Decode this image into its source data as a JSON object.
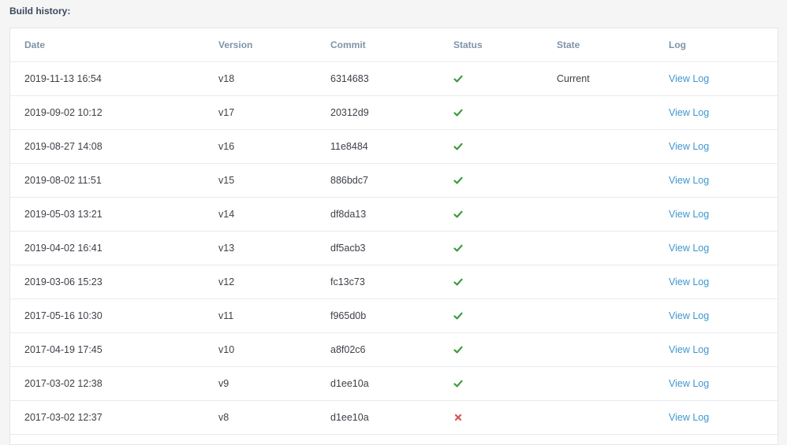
{
  "title": "Build history:",
  "columns": {
    "date": "Date",
    "version": "Version",
    "commit": "Commit",
    "status": "Status",
    "state": "State",
    "log": "Log"
  },
  "colors": {
    "success": "#3c9a3c",
    "failure": "#d9534f",
    "link": "#3f96cf"
  },
  "builds": [
    {
      "date": "2019-11-13 16:54",
      "version": "v18",
      "commit": "6314683",
      "status": "success",
      "state": "Current",
      "log": "View Log"
    },
    {
      "date": "2019-09-02 10:12",
      "version": "v17",
      "commit": "20312d9",
      "status": "success",
      "state": "",
      "log": "View Log"
    },
    {
      "date": "2019-08-27 14:08",
      "version": "v16",
      "commit": "11e8484",
      "status": "success",
      "state": "",
      "log": "View Log"
    },
    {
      "date": "2019-08-02 11:51",
      "version": "v15",
      "commit": "886bdc7",
      "status": "success",
      "state": "",
      "log": "View Log"
    },
    {
      "date": "2019-05-03 13:21",
      "version": "v14",
      "commit": "df8da13",
      "status": "success",
      "state": "",
      "log": "View Log"
    },
    {
      "date": "2019-04-02 16:41",
      "version": "v13",
      "commit": "df5acb3",
      "status": "success",
      "state": "",
      "log": "View Log"
    },
    {
      "date": "2019-03-06 15:23",
      "version": "v12",
      "commit": "fc13c73",
      "status": "success",
      "state": "",
      "log": "View Log"
    },
    {
      "date": "2017-05-16 10:30",
      "version": "v11",
      "commit": "f965d0b",
      "status": "success",
      "state": "",
      "log": "View Log"
    },
    {
      "date": "2017-04-19 17:45",
      "version": "v10",
      "commit": "a8f02c6",
      "status": "success",
      "state": "",
      "log": "View Log"
    },
    {
      "date": "2017-03-02 12:38",
      "version": "v9",
      "commit": "d1ee10a",
      "status": "success",
      "state": "",
      "log": "View Log"
    },
    {
      "date": "2017-03-02 12:37",
      "version": "v8",
      "commit": "d1ee10a",
      "status": "failure",
      "state": "",
      "log": "View Log"
    }
  ]
}
